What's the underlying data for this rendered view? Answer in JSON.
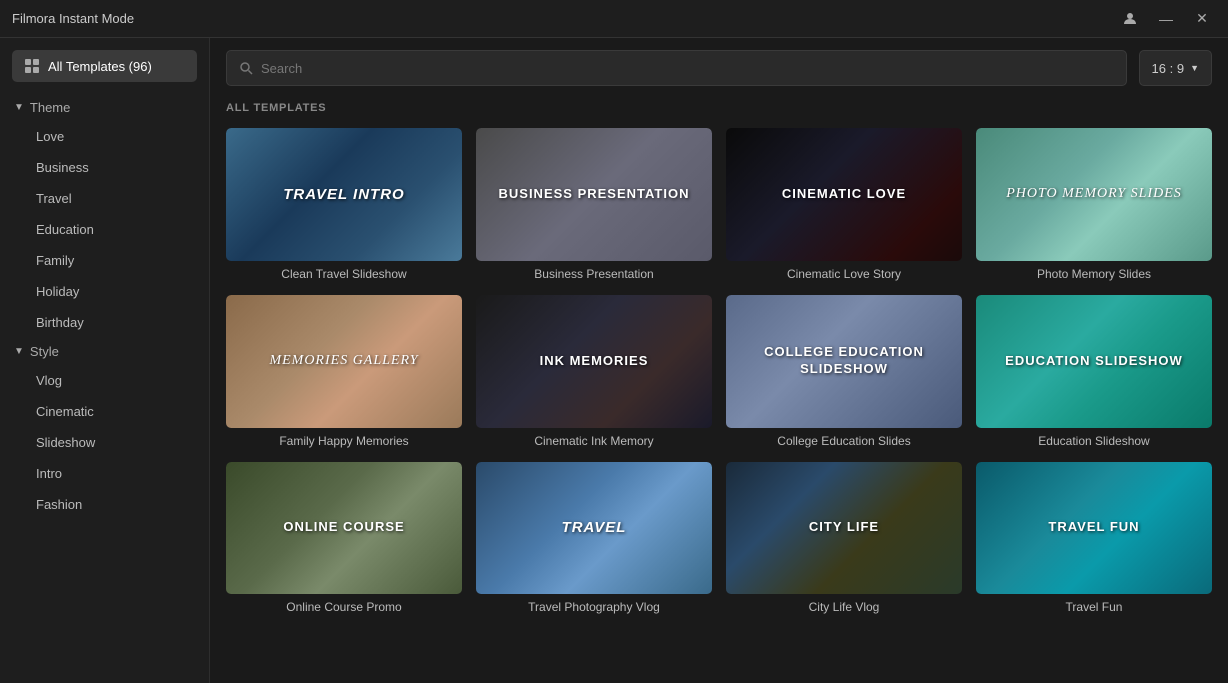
{
  "titlebar": {
    "title": "Filmora Instant Mode",
    "minimize": "—",
    "close": "✕"
  },
  "search": {
    "placeholder": "Search"
  },
  "aspect_ratio": {
    "label": "16 : 9"
  },
  "sidebar": {
    "all_templates": {
      "label": "All Templates (96)"
    },
    "theme": {
      "header": "Theme",
      "items": [
        "Love",
        "Business",
        "Travel",
        "Education",
        "Family",
        "Holiday",
        "Birthday"
      ]
    },
    "style": {
      "header": "Style",
      "items": [
        "Vlog",
        "Cinematic",
        "Slideshow",
        "Intro",
        "Fashion"
      ]
    }
  },
  "section_label": "ALL TEMPLATES",
  "templates": [
    {
      "id": "clean-travel",
      "name": "Clean Travel Slideshow",
      "thumb_class": "thumb-travel",
      "overlay_text": "TRAVEL INTRO",
      "overlay_style": "italic"
    },
    {
      "id": "business-pres",
      "name": "Business Presentation",
      "thumb_class": "thumb-business",
      "overlay_text": "BUSINESS PRESENTATION",
      "overlay_style": "normal"
    },
    {
      "id": "cinematic-love",
      "name": "Cinematic Love Story",
      "thumb_class": "thumb-cinematic",
      "overlay_text": "CINEMATIC LOVE",
      "overlay_style": "normal"
    },
    {
      "id": "photo-memory",
      "name": "Photo Memory Slides",
      "thumb_class": "thumb-photo",
      "overlay_text": "Photo Memory Slides",
      "overlay_style": "script"
    },
    {
      "id": "family-happy",
      "name": "Family Happy Memories",
      "thumb_class": "thumb-family",
      "overlay_text": "Memories Gallery",
      "overlay_style": "script"
    },
    {
      "id": "cinematic-ink",
      "name": "Cinematic Ink Memory",
      "thumb_class": "thumb-ink",
      "overlay_text": "INK MEMORIES",
      "overlay_style": "normal"
    },
    {
      "id": "college-edu",
      "name": "College Education Slides",
      "thumb_class": "thumb-college",
      "overlay_text": "COLLEGE EDUCATION SLIDESHOW",
      "overlay_style": "normal"
    },
    {
      "id": "edu-slideshow",
      "name": "Education Slideshow",
      "thumb_class": "thumb-edu-slide",
      "overlay_text": "Education Slideshow",
      "overlay_style": "normal"
    },
    {
      "id": "online-course",
      "name": "Online Course Promo",
      "thumb_class": "thumb-online",
      "overlay_text": "ONLINE COURSE",
      "overlay_style": "normal"
    },
    {
      "id": "travel-photo",
      "name": "Travel Photography Vlog",
      "thumb_class": "thumb-travel-photo",
      "overlay_text": "Travel",
      "overlay_style": "italic"
    },
    {
      "id": "city-life",
      "name": "City Life Vlog",
      "thumb_class": "thumb-city",
      "overlay_text": "CITY LIFE",
      "overlay_style": "normal"
    },
    {
      "id": "travel-fun",
      "name": "Travel Fun",
      "thumb_class": "thumb-travel-fun",
      "overlay_text": "TRAVEL FUN",
      "overlay_style": "normal"
    }
  ]
}
